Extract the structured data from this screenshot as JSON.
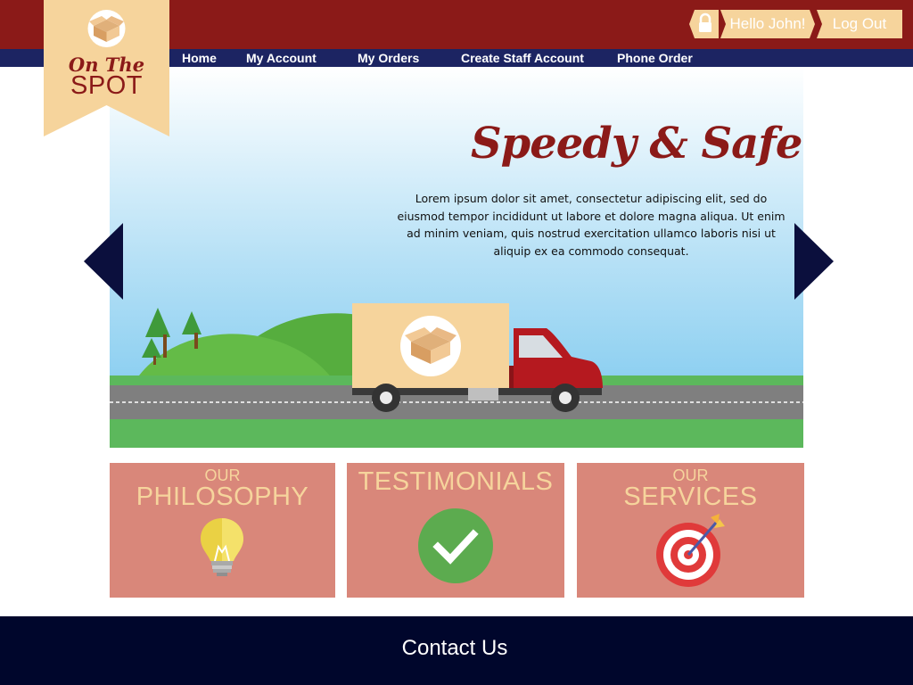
{
  "brand": {
    "script_line": "On The",
    "name_line": "SPOT",
    "logo_icon": "box-icon"
  },
  "nav": {
    "items": [
      {
        "label": "Home"
      },
      {
        "label": "My Account"
      },
      {
        "label": "My Orders"
      },
      {
        "label": "Create Staff Account"
      },
      {
        "label": "Phone Order"
      }
    ]
  },
  "user": {
    "lock_icon": "lock-icon",
    "greeting": "Hello John!",
    "logout_label": "Log Out"
  },
  "hero": {
    "title": "Speedy & Safe",
    "body": "Lorem ipsum dolor sit amet, consectetur adipiscing elit, sed do eiusmod tempor incididunt ut labore et dolore magna aliqua. Ut enim ad minim veniam, quis nostrud exercitation ullamco laboris nisi ut aliquip ex ea commodo consequat.",
    "prev_icon": "chevron-left-icon",
    "next_icon": "chevron-right-icon"
  },
  "cards": [
    {
      "sub": "OUR",
      "title": "PHILOSOPHY",
      "icon": "lightbulb-icon"
    },
    {
      "sub": "",
      "title": "TESTIMONIALS",
      "icon": "checkmark-icon"
    },
    {
      "sub": "OUR",
      "title": "SERVICES",
      "icon": "target-icon"
    }
  ],
  "footer": {
    "contact_label": "Contact Us"
  },
  "colors": {
    "header_red": "#8b1a18",
    "nav_navy": "#1c2462",
    "ribbon_cream": "#f6d49c",
    "card_salmon": "#d9877a",
    "footer_navy": "#00062c",
    "grass_green": "#5cb85c",
    "sky_blue": "#86cdf0"
  }
}
